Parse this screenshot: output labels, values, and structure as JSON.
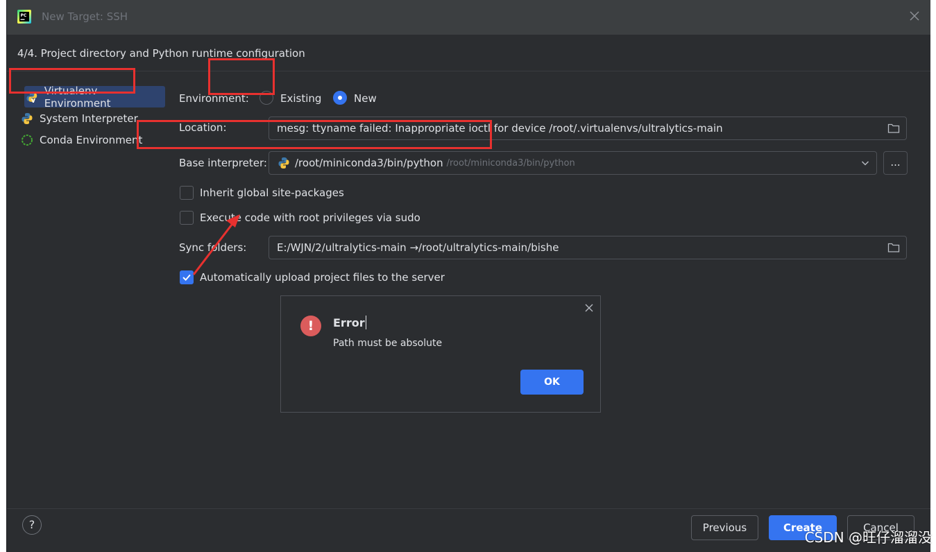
{
  "window": {
    "title": "New Target: SSH"
  },
  "step": {
    "title": "4/4. Project directory and Python runtime configuration"
  },
  "environments": [
    {
      "label": "Virtualenv Environment",
      "icon": "virtualenv-icon"
    },
    {
      "label": "System Interpreter",
      "icon": "python-icon"
    },
    {
      "label": "Conda Environment",
      "icon": "conda-icon"
    }
  ],
  "form": {
    "environment_label": "Environment:",
    "existing_label": "Existing",
    "new_label": "New",
    "selected_environment": "New",
    "location_label": "Location:",
    "location_value": "mesg: ttyname failed: Inappropriate ioctl for device /root/.virtualenvs/ultralytics-main",
    "base_interpreter_label": "Base interpreter:",
    "base_interpreter_value": "/root/miniconda3/bin/python",
    "base_interpreter_hint": "/root/miniconda3/bin/python",
    "browse_label": "...",
    "inherit_label": "Inherit global site-packages",
    "inherit_checked": false,
    "sudo_label": "Execute code with root privileges via sudo",
    "sudo_checked": false,
    "sync_label": "Sync folders:",
    "sync_value": "E:/WJN/2/ultralytics-main →/root/ultralytics-main/bishe",
    "upload_label": "Automatically upload project files to the server",
    "upload_checked": true
  },
  "error_dialog": {
    "title": "Error",
    "message": "Path must be absolute",
    "ok_label": "OK",
    "icon": "error-icon"
  },
  "footer": {
    "help_label": "?",
    "previous_label": "Previous",
    "create_label": "Create",
    "cancel_label": "Cancel"
  },
  "watermark": "CSDN @旺仔溜溜没",
  "colors": {
    "background": "#2b2d30",
    "titlebar": "#3c3f41",
    "accent": "#3574f0",
    "error": "#db5c5c",
    "annotation": "#e8312f"
  }
}
